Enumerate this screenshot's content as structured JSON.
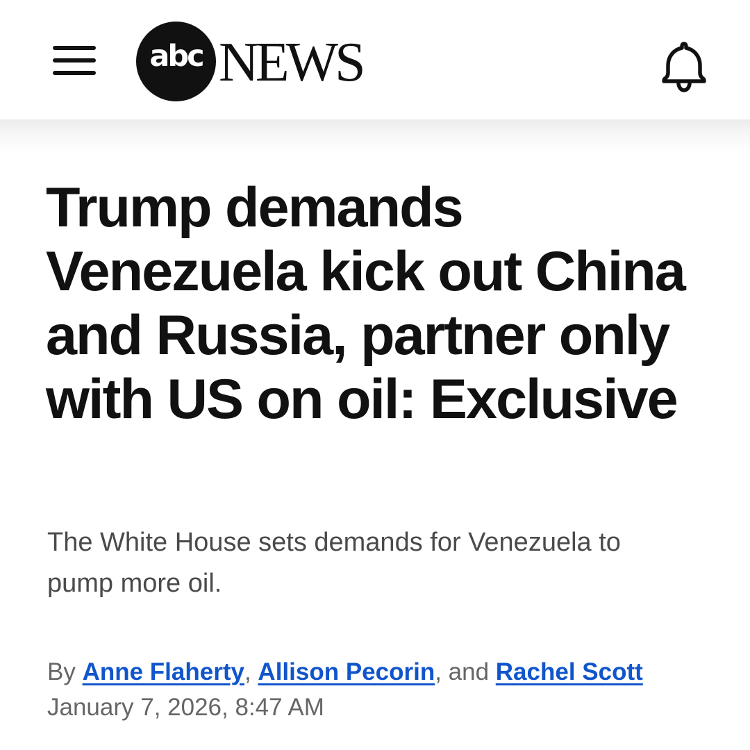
{
  "app": {
    "logo_abc": "abc",
    "logo_news": "NEWS",
    "menu_icon": "hamburger-menu-icon",
    "notification_icon": "bell-icon"
  },
  "article": {
    "headline": "Trump demands Venezuela kick out China and Russia, partner only with US on oil: Exclusive",
    "dek": "The White House sets demands for Venezuela to pump more oil.",
    "byline": {
      "prefix": "By ",
      "authors": [
        "Anne Flaherty",
        "Allison Pecorin",
        "Rachel Scott"
      ],
      "separator": ", ",
      "conjunction": ", and "
    },
    "timestamp": "January 7, 2026, 8:47 AM"
  },
  "colors": {
    "text": "#111111",
    "muted": "#666666",
    "dek": "#4a4a4a",
    "link": "#1155cc",
    "background": "#ffffff"
  }
}
